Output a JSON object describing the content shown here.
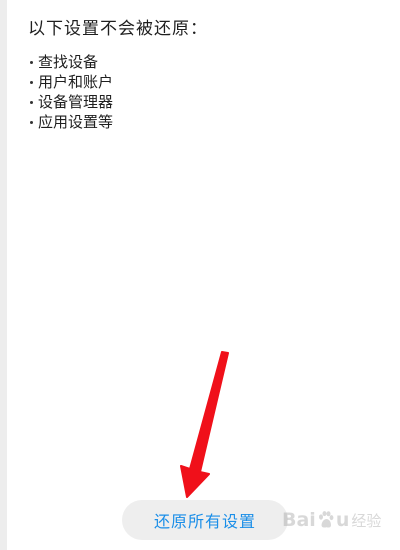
{
  "notice": {
    "heading": "以下设置不会被还原：",
    "items": [
      "查找设备",
      "用户和账户",
      "设备管理器",
      "应用设置等"
    ]
  },
  "actions": {
    "reset_all_label": "还原所有设置"
  },
  "watermark": {
    "brand_left": "Bai",
    "brand_right": "u",
    "brand_cn": "经验"
  },
  "colors": {
    "accent_text": "#1a8ee8",
    "button_bg": "#eeeeee",
    "arrow": "#f0101a"
  },
  "icons": {
    "annotation": "red-arrow-icon",
    "watermark_logo": "baidu-paw-icon"
  }
}
